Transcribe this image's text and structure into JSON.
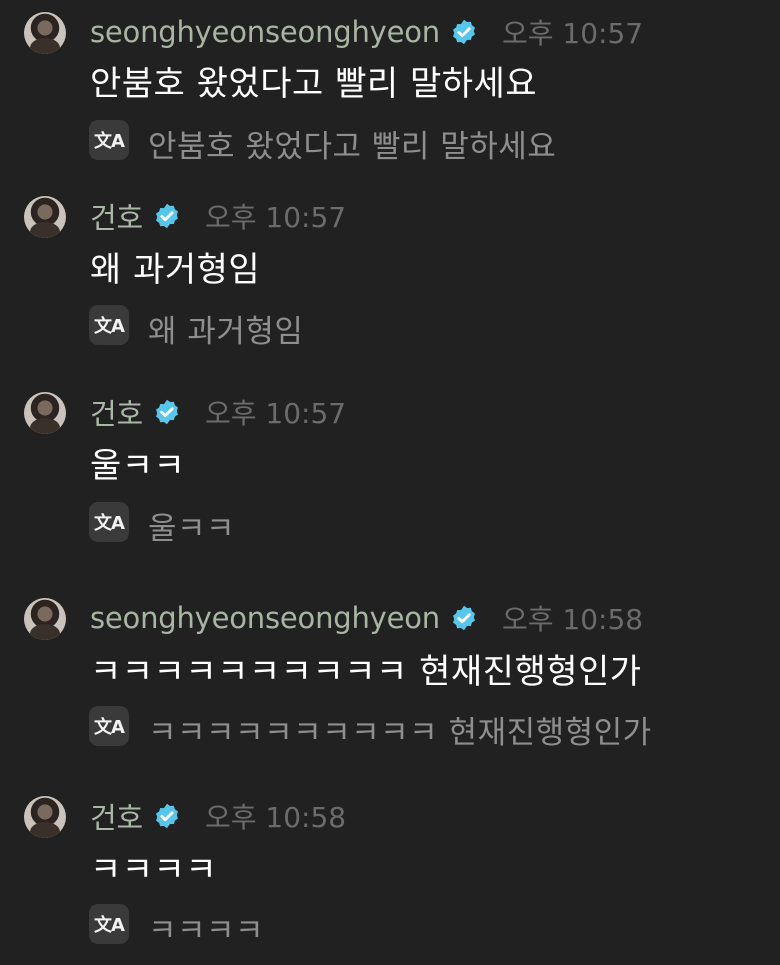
{
  "colors": {
    "background": "#212121",
    "username": "#a8b5a3",
    "timestamp": "#6b6b6b",
    "verified_badge": "#56c6ea",
    "translation_text": "#8e8e8e"
  },
  "translate_icon_label": "文A",
  "messages": [
    {
      "username": "seonghyeonseonghyeon",
      "time": "오후 10:57",
      "text": "안붐호 왔었다고 빨리 말하세요",
      "translation": "안붐호 왔었다고 빨리 말하세요"
    },
    {
      "username": "건호",
      "time": "오후 10:57",
      "text": "왜 과거형임",
      "translation": "왜 과거형임"
    },
    {
      "username": "건호",
      "time": "오후 10:57",
      "text": "울ㅋㅋ",
      "translation": "울ㅋㅋ"
    },
    {
      "username": "seonghyeonseonghyeon",
      "time": "오후 10:58",
      "text": "ㅋㅋㅋㅋㅋㅋㅋㅋㅋㅋ 현재진행형인가",
      "translation": "ㅋㅋㅋㅋㅋㅋㅋㅋㅋㅋ 현재진행형인가"
    },
    {
      "username": "건호",
      "time": "오후 10:58",
      "text": "ㅋㅋㅋㅋ",
      "translation": "ㅋㅋㅋㅋ"
    }
  ]
}
